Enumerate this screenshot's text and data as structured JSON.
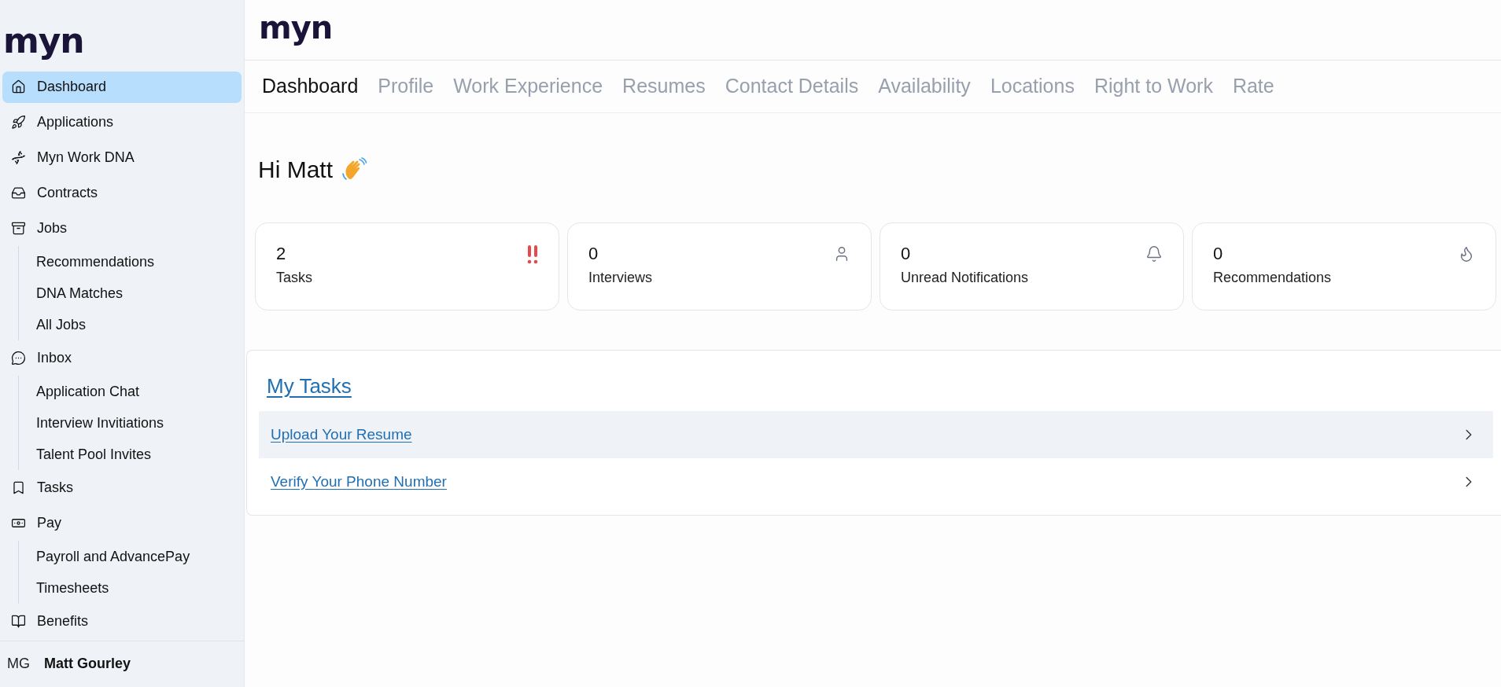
{
  "sidebar": {
    "logo": "myn",
    "items": [
      {
        "label": "Dashboard",
        "selected": true
      },
      {
        "label": "Applications",
        "selected": false
      },
      {
        "label": "Myn Work DNA",
        "selected": false
      },
      {
        "label": "Contracts",
        "selected": false
      },
      {
        "label": "Jobs",
        "selected": false,
        "children": [
          {
            "label": "Recommendations",
            "selected": false
          },
          {
            "label": "DNA Matches",
            "selected": false
          },
          {
            "label": "All Jobs",
            "selected": false
          }
        ]
      },
      {
        "label": "Inbox",
        "selected": false,
        "children": [
          {
            "label": "Application Chat",
            "selected": false
          },
          {
            "label": "Interview Invitiations",
            "selected": false
          },
          {
            "label": "Talent Pool Invites",
            "selected": false
          }
        ]
      },
      {
        "label": "Tasks",
        "selected": false
      },
      {
        "label": "Pay",
        "selected": false,
        "children": [
          {
            "label": "Payroll and AdvancePay",
            "selected": false
          },
          {
            "label": "Timesheets",
            "selected": false
          }
        ]
      },
      {
        "label": "Benefits",
        "selected": false
      }
    ],
    "user": {
      "initials": "MG",
      "name": "Matt Gourley"
    }
  },
  "header": {
    "logo": "myn"
  },
  "tabs": [
    {
      "label": "Dashboard",
      "selected": true
    },
    {
      "label": "Profile",
      "selected": false
    },
    {
      "label": "Work Experience",
      "selected": false
    },
    {
      "label": "Resumes",
      "selected": false
    },
    {
      "label": "Contact Details",
      "selected": false
    },
    {
      "label": "Availability",
      "selected": false
    },
    {
      "label": "Locations",
      "selected": false
    },
    {
      "label": "Right to Work",
      "selected": false
    },
    {
      "label": "Rate",
      "selected": false
    }
  ],
  "greeting": "Hi Matt",
  "cards": [
    {
      "value": "2",
      "label": "Tasks"
    },
    {
      "value": "0",
      "label": "Interviews"
    },
    {
      "value": "0",
      "label": "Unread Notifications"
    },
    {
      "value": "0",
      "label": "Recommendations"
    }
  ],
  "my_tasks": {
    "title": "My Tasks",
    "rows": [
      {
        "label": "Upload Your Resume",
        "selected": true
      },
      {
        "label": "Verify Your Phone Number",
        "selected": false
      }
    ]
  }
}
